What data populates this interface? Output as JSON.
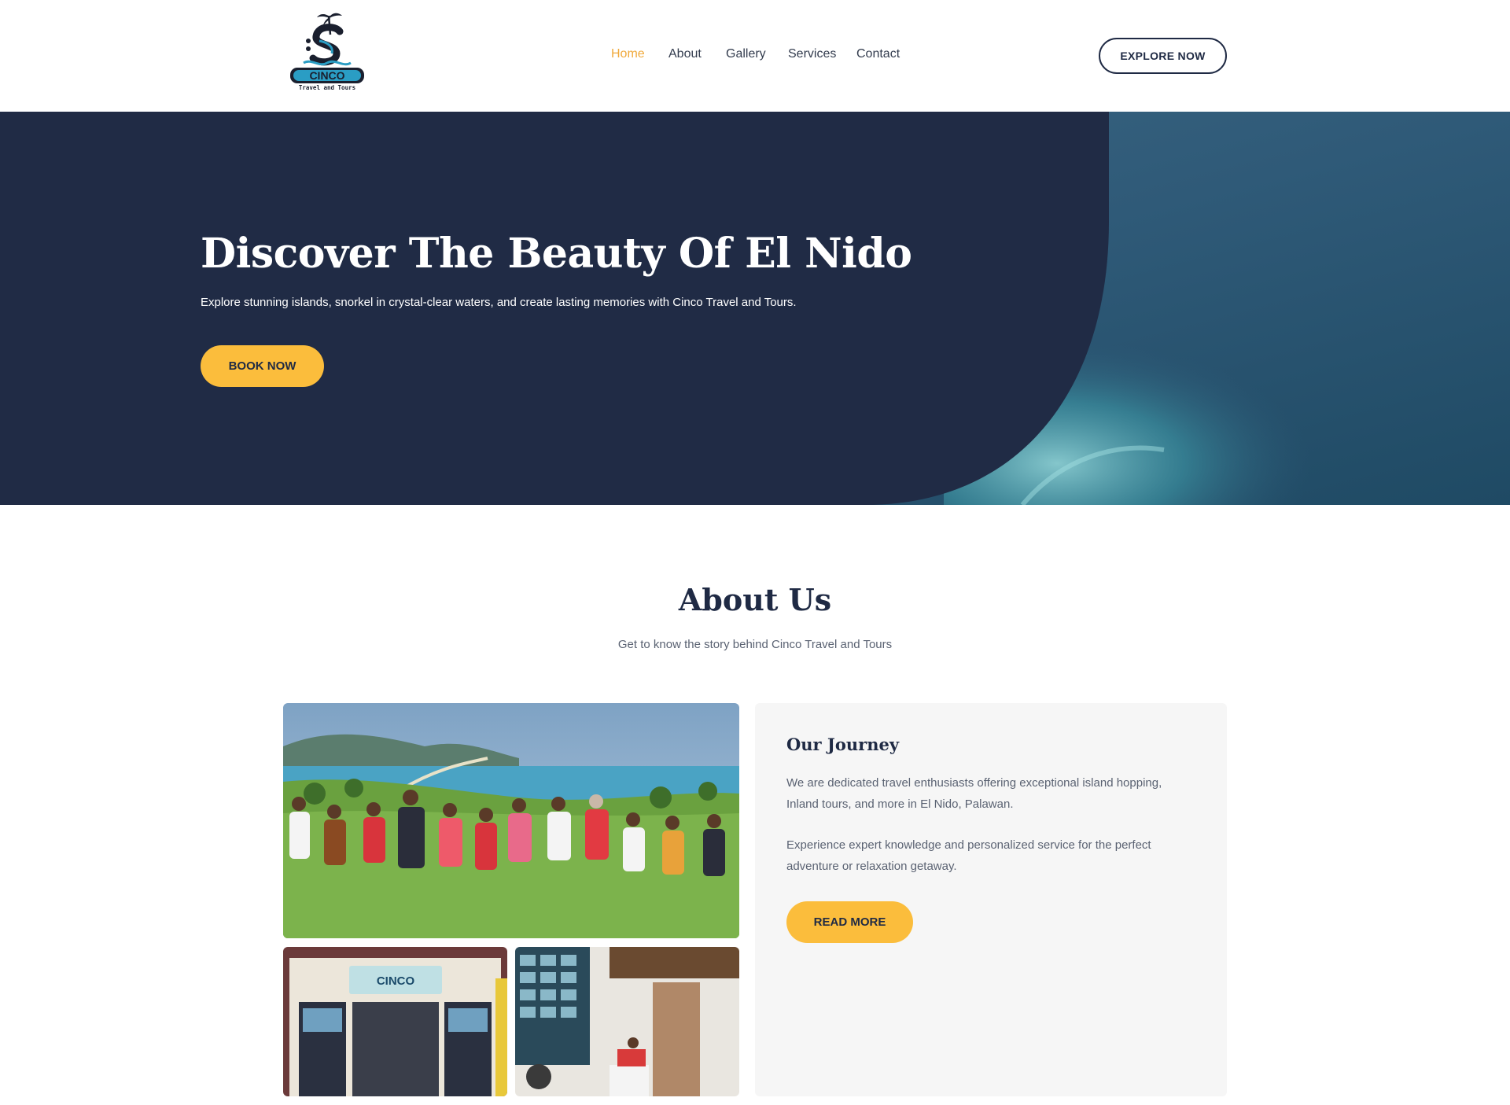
{
  "header": {
    "logo_text": "CINCO",
    "logo_tagline": "Travel and Tours",
    "nav": [
      {
        "label": "Home",
        "active": true
      },
      {
        "label": "About",
        "active": false
      },
      {
        "label": "Gallery",
        "active": false
      },
      {
        "label": "Services",
        "active": false
      },
      {
        "label": "Contact",
        "active": false
      }
    ],
    "cta_label": "EXPLORE NOW"
  },
  "hero": {
    "title": "Discover The Beauty Of El Nido",
    "subtitle": "Explore stunning islands, snorkel in crystal-clear waters, and create lasting memories with Cinco Travel and Tours.",
    "button_label": "BOOK NOW"
  },
  "about": {
    "title": "About Us",
    "subtitle": "Get to know the story behind Cinco Travel and Tours",
    "card": {
      "title": "Our Journey",
      "paragraph1": "We are dedicated travel enthusiasts offering exceptional island hopping, Inland tours, and more in El Nido, Palawan.",
      "paragraph2": "Experience expert knowledge and personalized service for the perfect adventure or relaxation getaway.",
      "button_label": "READ MORE"
    }
  },
  "colors": {
    "navy": "#1f2a44",
    "accent": "#fbbd3c",
    "nav_active": "#f0a93b",
    "card_bg": "#f6f6f6"
  }
}
